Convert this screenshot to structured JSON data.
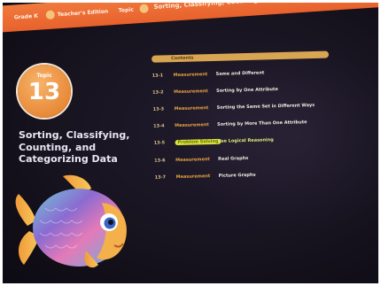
{
  "header": {
    "unit": "Grade K",
    "edition": "Teacher's Edition",
    "topic_tag": "Topic",
    "title": "Sorting, Classifying, Counting, and Categorizing Data"
  },
  "topic_badge": {
    "label": "Topic",
    "number": "13"
  },
  "main_title": [
    "Sorting, Classifying,",
    "Counting, and",
    "Categorizing Data"
  ],
  "contents": {
    "label": "Contents",
    "lessons": [
      {
        "num": "13-1",
        "strand": "Measurement",
        "title": "Same and Different",
        "highlighted": false
      },
      {
        "num": "13-2",
        "strand": "Measurement",
        "title": "Sorting by One Attribute",
        "highlighted": false
      },
      {
        "num": "13-3",
        "strand": "Measurement",
        "title": "Sorting the Same Set in Different Ways",
        "highlighted": false
      },
      {
        "num": "13-4",
        "strand": "Measurement",
        "title": "Sorting by More Than One Attribute",
        "highlighted": false
      },
      {
        "num": "13-5",
        "strand": "Problem Solving",
        "title": "Use Logical Reasoning",
        "highlighted": true
      },
      {
        "num": "13-6",
        "strand": "Measurement",
        "title": "Real Graphs",
        "highlighted": false
      },
      {
        "num": "13-7",
        "strand": "Measurement",
        "title": "Picture Graphs",
        "highlighted": false
      }
    ]
  },
  "colors": {
    "header": "#e8612c",
    "badge": "#e88a38",
    "contents_bar": "#d8a553",
    "highlight": "#d7e33a",
    "background": "#17131f"
  }
}
